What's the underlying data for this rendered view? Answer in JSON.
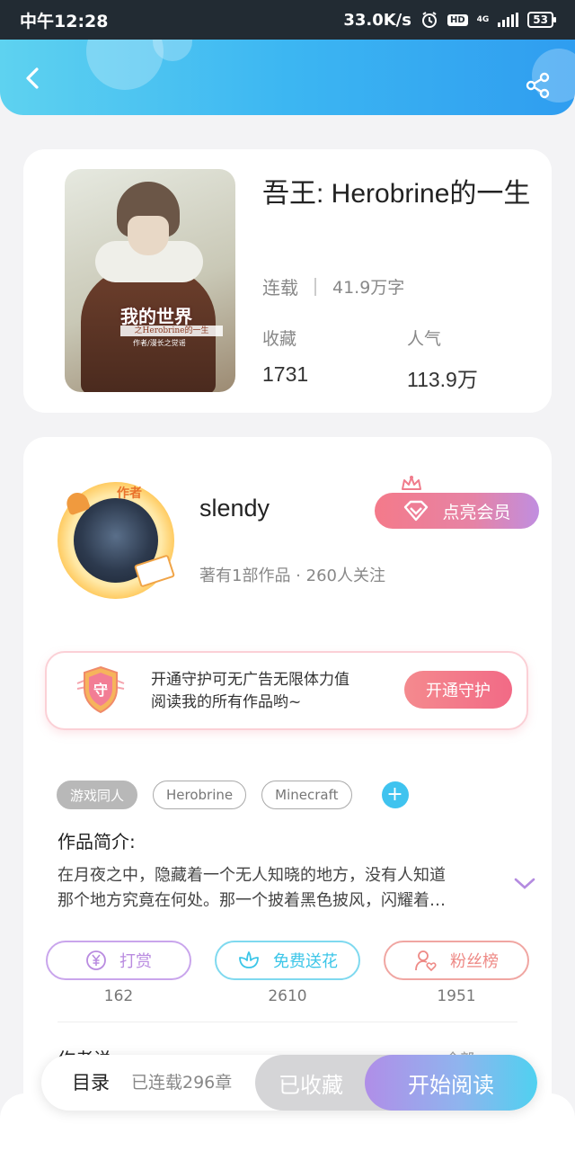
{
  "status_bar": {
    "time": "中午12:28",
    "net_speed": "33.0K/s",
    "hd": "HD",
    "network": "4G",
    "battery": "53",
    "icons": [
      "alarm-icon",
      "signal-icon",
      "battery-icon"
    ]
  },
  "header": {
    "back_icon": "chevron-left-icon",
    "share_icon": "share-icon"
  },
  "book": {
    "cover_title": "我的世界",
    "cover_subtitle": "之Herobrine的一生",
    "cover_author": "作者/漫长之觉谣",
    "title": "吾王: Herobrine的一生",
    "status": "连载",
    "word_count": "41.9万字",
    "stats": {
      "favorites_label": "收藏",
      "favorites_value": "1731",
      "popularity_label": "人气",
      "popularity_value": "113.9万"
    }
  },
  "author": {
    "badge": "作者",
    "name": "slendy",
    "meta": "著有1部作品 · 260人关注",
    "vip_button": "点亮会员"
  },
  "guard": {
    "shield_char": "守",
    "text_line1": "开通守护可无广告无限体力值",
    "text_line2": "阅读我的所有作品哟~",
    "button": "开通守护"
  },
  "tags": [
    "游戏同人",
    "Herobrine",
    "Minecraft"
  ],
  "intro": {
    "heading": "作品简介:",
    "text_line1": "在月夜之中，隐藏着一个无人知晓的地方，没有人知道",
    "text_line2": "那个地方究竟在何处。那一个披着黑色披风，闪耀着…"
  },
  "actions": [
    {
      "label": "打赏",
      "count": "162",
      "color": "#b98be0"
    },
    {
      "label": "免费送花",
      "count": "2610",
      "color": "#3cc6e8"
    },
    {
      "label": "粉丝榜",
      "count": "1951",
      "color": "#ee8a86"
    }
  ],
  "peek": {
    "heading": "作者说",
    "link": "全部"
  },
  "bottom_bar": {
    "toc": "目录",
    "chapters": "已连载296章",
    "collected": "已收藏",
    "read": "开始阅读"
  },
  "colors": {
    "header_accent": "#3cb6f2",
    "vip_gradient_start": "#f47a8a",
    "read_gradient_end": "#4fd1f0"
  }
}
